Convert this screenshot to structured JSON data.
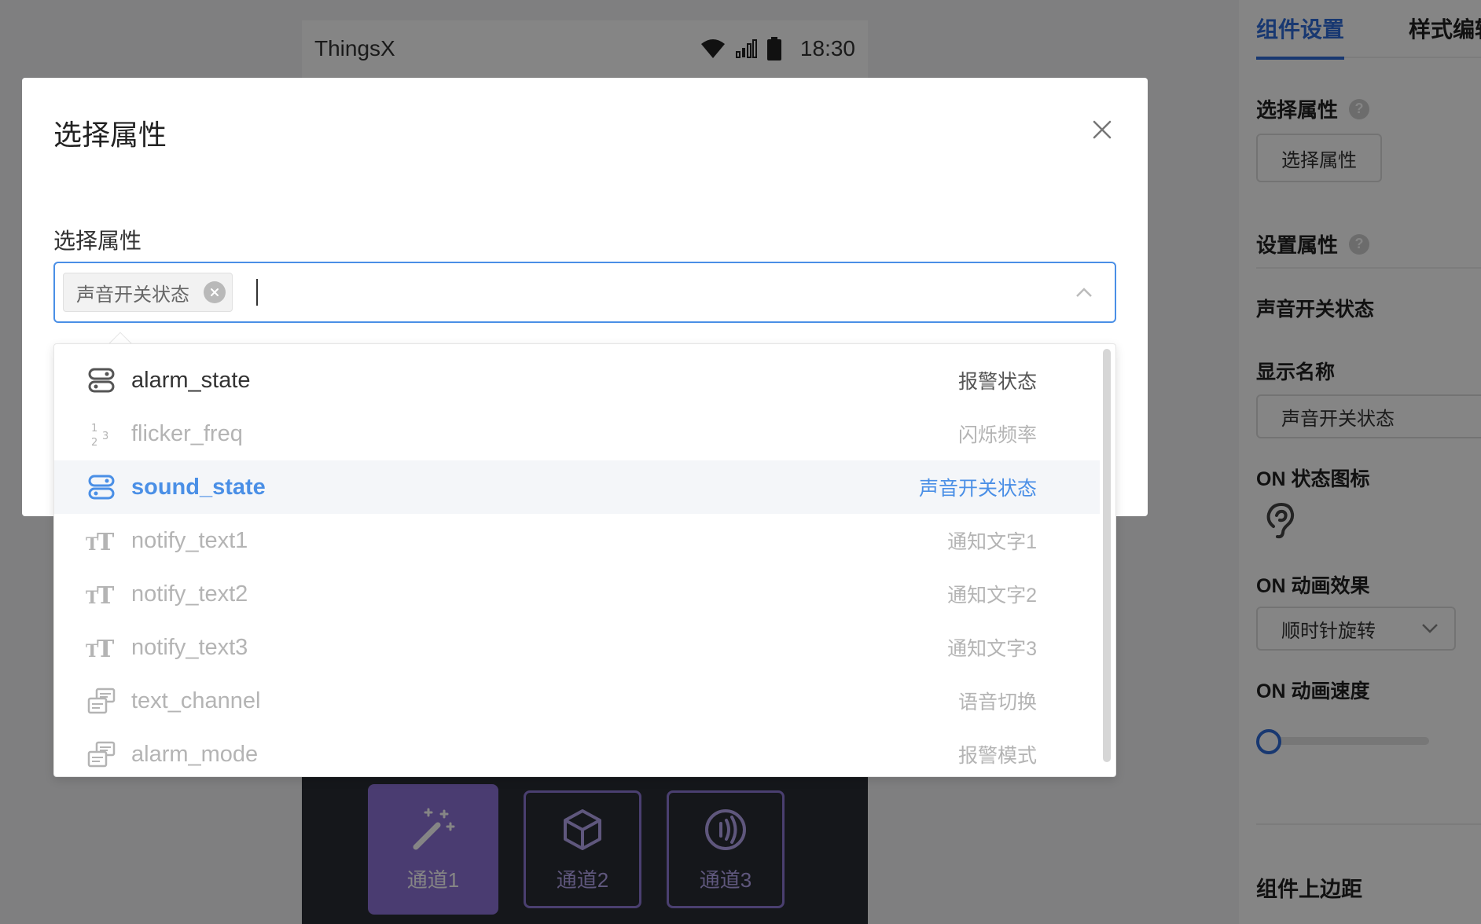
{
  "phone": {
    "app_name": "ThingsX",
    "time": "18:30",
    "channels": [
      {
        "label": "通道1",
        "icon": "magic-wand-icon",
        "active": true
      },
      {
        "label": "通道2",
        "icon": "cube-icon",
        "active": false
      },
      {
        "label": "通道3",
        "icon": "nfc-icon",
        "active": false
      }
    ]
  },
  "right_panel": {
    "tabs": [
      {
        "label": "组件设置",
        "active": true
      },
      {
        "label": "样式编辑",
        "active": false
      }
    ],
    "select_attr_title": "选择属性",
    "select_attr_button": "选择属性",
    "set_attr_title": "设置属性",
    "attr_name": "声音开关状态",
    "display_name_label": "显示名称",
    "display_name_value": "声音开关状态",
    "on_icon_label": "ON 状态图标",
    "on_anim_label": "ON 动画效果",
    "on_anim_value": "顺时针旋转",
    "on_speed_label": "ON 动画速度",
    "on_speed_value": 0,
    "top_margin_label": "组件上边距"
  },
  "modal": {
    "title": "选择属性",
    "field_label": "选择属性",
    "selected_tag": "声音开关状态"
  },
  "dropdown": {
    "items": [
      {
        "name": "alarm_state",
        "label": "报警状态",
        "icon": "toggle-icon",
        "state": "enabled"
      },
      {
        "name": "flicker_freq",
        "label": "闪烁频率",
        "icon": "number-icon",
        "state": "disabled"
      },
      {
        "name": "sound_state",
        "label": "声音开关状态",
        "icon": "toggle-icon",
        "state": "selected"
      },
      {
        "name": "notify_text1",
        "label": "通知文字1",
        "icon": "text-icon",
        "state": "disabled"
      },
      {
        "name": "notify_text2",
        "label": "通知文字2",
        "icon": "text-icon",
        "state": "disabled"
      },
      {
        "name": "notify_text3",
        "label": "通知文字3",
        "icon": "text-icon",
        "state": "disabled"
      },
      {
        "name": "text_channel",
        "label": "语音切换",
        "icon": "enum-icon",
        "state": "disabled"
      },
      {
        "name": "alarm_mode",
        "label": "报警模式",
        "icon": "enum-icon",
        "state": "disabled"
      }
    ]
  },
  "colors": {
    "accent": "#4a8fe6",
    "brand_purple": "#8e73d8",
    "tab_active": "#2f6bd8"
  }
}
